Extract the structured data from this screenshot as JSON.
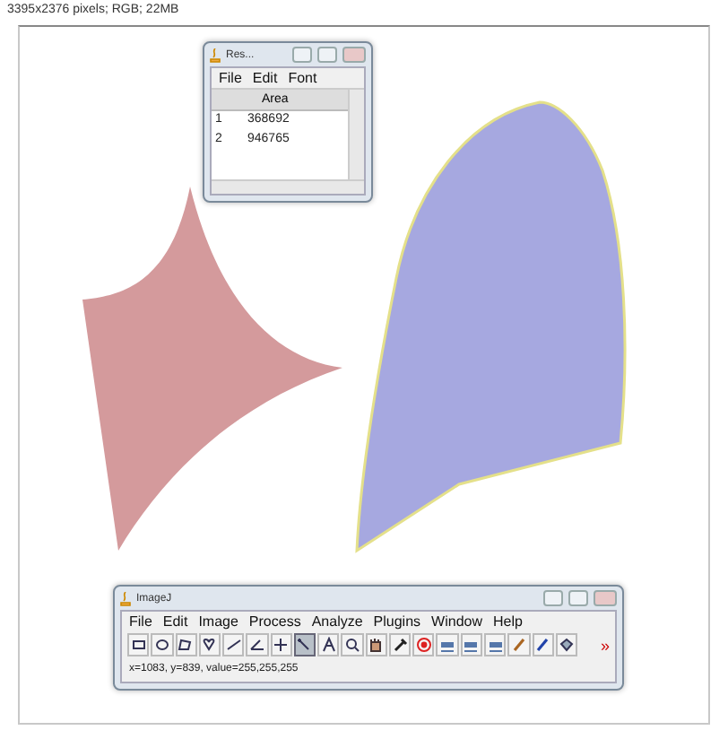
{
  "info": "3395x2376 pixels; RGB; 22MB",
  "results_window": {
    "title": "Res...",
    "menu": [
      "File",
      "Edit",
      "Font"
    ],
    "column": "Area",
    "rows": [
      {
        "index": "1",
        "area": "368692"
      },
      {
        "index": "2",
        "area": "946765"
      }
    ]
  },
  "imagej_window": {
    "title": "ImageJ",
    "menu": [
      "File",
      "Edit",
      "Image",
      "Process",
      "Analyze",
      "Plugins",
      "Window",
      "Help"
    ],
    "tools": [
      {
        "kind": "rectangle",
        "selected": false
      },
      {
        "kind": "oval",
        "selected": false
      },
      {
        "kind": "polygon",
        "selected": false
      },
      {
        "kind": "freehand",
        "selected": false
      },
      {
        "kind": "line",
        "selected": false
      },
      {
        "kind": "angle",
        "selected": false
      },
      {
        "kind": "point",
        "selected": false
      },
      {
        "kind": "wand",
        "selected": true
      },
      {
        "kind": "text",
        "selected": false
      },
      {
        "kind": "zoom",
        "selected": false
      },
      {
        "kind": "hand",
        "selected": false
      },
      {
        "kind": "dropper",
        "selected": false
      },
      {
        "kind": "target",
        "selected": false
      },
      {
        "kind": "dev",
        "selected": false
      },
      {
        "kind": "stk",
        "selected": false
      },
      {
        "kind": "lut",
        "selected": false
      },
      {
        "kind": "pencil",
        "selected": false
      },
      {
        "kind": "brush",
        "selected": false
      },
      {
        "kind": "fill",
        "selected": false
      }
    ],
    "more": "»",
    "status": "x=1083, y=839, value=255,255,255"
  }
}
